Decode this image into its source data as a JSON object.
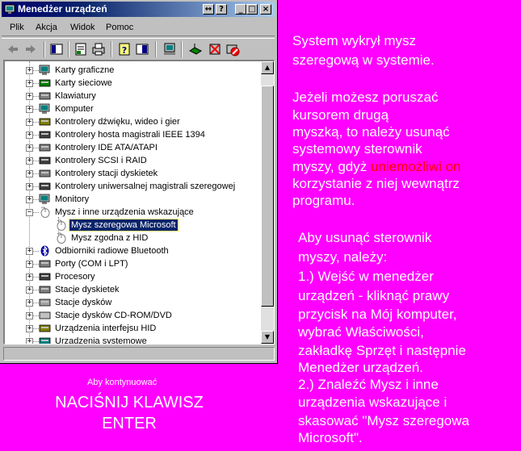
{
  "window": {
    "title": "Menedżer urządzeń",
    "title_buttons": [
      "◂▸",
      "?",
      "_",
      "□",
      "×"
    ],
    "menu": [
      "Plik",
      "Akcja",
      "Widok",
      "Pomoc"
    ]
  },
  "tree": {
    "items": [
      {
        "label": "Karty graficzne",
        "icon": "display-adapter-icon",
        "expanded": false,
        "level": 0
      },
      {
        "label": "Karty sieciowe",
        "icon": "network-card-icon",
        "expanded": false,
        "level": 0
      },
      {
        "label": "Klawiatury",
        "icon": "keyboard-icon",
        "expanded": false,
        "level": 0
      },
      {
        "label": "Komputer",
        "icon": "computer-icon",
        "expanded": false,
        "level": 0
      },
      {
        "label": "Kontrolery dźwięku, wideo i gier",
        "icon": "sound-icon",
        "expanded": false,
        "level": 0
      },
      {
        "label": "Kontrolery hosta magistrali IEEE 1394",
        "icon": "ieee1394-icon",
        "expanded": false,
        "level": 0
      },
      {
        "label": "Kontrolery IDE ATA/ATAPI",
        "icon": "ide-controller-icon",
        "expanded": false,
        "level": 0
      },
      {
        "label": "Kontrolery SCSI i RAID",
        "icon": "scsi-icon",
        "expanded": false,
        "level": 0
      },
      {
        "label": "Kontrolery stacji dyskietek",
        "icon": "floppy-controller-icon",
        "expanded": false,
        "level": 0
      },
      {
        "label": "Kontrolery uniwersalnej magistrali szeregowej",
        "icon": "usb-icon",
        "expanded": false,
        "level": 0
      },
      {
        "label": "Monitory",
        "icon": "monitor-icon",
        "expanded": false,
        "level": 0
      },
      {
        "label": "Mysz i inne urządzenia wskazujące",
        "icon": "mouse-icon",
        "expanded": true,
        "level": 0
      },
      {
        "label": "Mysz szeregowa Microsoft",
        "icon": "mouse-icon",
        "level": 1,
        "selected": true
      },
      {
        "label": "Mysz zgodna z HID",
        "icon": "mouse-icon",
        "level": 1
      },
      {
        "label": "Odbiorniki radiowe Bluetooth",
        "icon": "bluetooth-icon",
        "expanded": false,
        "level": 0
      },
      {
        "label": "Porty (COM i LPT)",
        "icon": "port-icon",
        "expanded": false,
        "level": 0
      },
      {
        "label": "Procesory",
        "icon": "processor-icon",
        "expanded": false,
        "level": 0
      },
      {
        "label": "Stacje dyskietek",
        "icon": "floppy-drive-icon",
        "expanded": false,
        "level": 0
      },
      {
        "label": "Stacje dysków",
        "icon": "disk-drive-icon",
        "expanded": false,
        "level": 0
      },
      {
        "label": "Stacje dysków CD-ROM/DVD",
        "icon": "cdrom-icon",
        "expanded": false,
        "level": 0
      },
      {
        "label": "Urządzenia interfejsu HID",
        "icon": "hid-icon",
        "expanded": false,
        "level": 0
      },
      {
        "label": "Urządzenia systemowe",
        "icon": "system-devices-icon",
        "expanded": false,
        "level": 0
      }
    ]
  },
  "info": {
    "para1": [
      "System wykrył mysz",
      "szeregową w systemie."
    ],
    "para2_lines": [
      "Jeżeli możesz poruszać",
      "kursorem drugą",
      "myszką, to należy usunąć",
      "systemowy sterownik"
    ],
    "para2_pre_red": "myszy, gdyż ",
    "para2_red": "uniemożliwi on",
    "para2_tail": [
      "korzystanie z niej wewnątrz",
      "programu."
    ],
    "para3": [
      "Aby usunąć sterownik",
      "myszy, należy:",
      "1.) Wejść w menedżer",
      "urządzeń - kliknąć prawy",
      "przycisk na Mój komputer,",
      "wybrać Właściwości,",
      "zakładkę Sprzęt i następnie",
      "Menedżer urządzeń.",
      "2.) Znaleźć Mysz i inne",
      "urządzenia wskazujące i",
      "skasować \"Mysz szeregowa",
      "Microsoft\"."
    ]
  },
  "prompt": {
    "small": "Aby kontynuować",
    "big_line1": "NACIŚNIJ KLAWISZ",
    "big_line2": "ENTER"
  },
  "colors": {
    "background": "#ff00ff",
    "text": "#ffffff",
    "highlight": "#ff0000",
    "selection": "#0a246a"
  }
}
